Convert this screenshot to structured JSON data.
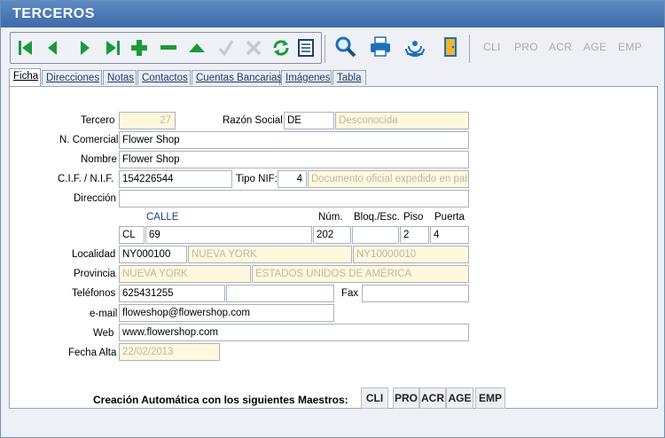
{
  "window": {
    "title": "TERCEROS"
  },
  "toolbar": {
    "nav_icons": [
      "first-icon",
      "prev-icon",
      "next-icon",
      "last-icon",
      "add-icon",
      "remove-icon",
      "up-icon",
      "confirm-icon",
      "cancel-icon",
      "refresh-icon",
      "list-icon"
    ],
    "tool_icons": [
      "search-icon",
      "print-icon",
      "signal-icon",
      "exit-door-icon"
    ],
    "text_buttons": [
      "CLI",
      "PRO",
      "ACR",
      "AGE",
      "EMP"
    ]
  },
  "tabs": [
    "Ficha",
    "Direcciones",
    "Notas",
    "Contactos",
    "Cuentas Bancarias",
    "Imágenes",
    "Tabla"
  ],
  "form": {
    "tercero_label": "Tercero",
    "tercero_value": "27",
    "razon_label": "Razón Social",
    "razon_code": "DE",
    "razon_desc": "Desconocida",
    "comercial_label": "N. Comercial",
    "comercial_value": "Flower Shop",
    "nombre_label": "Nombre",
    "nombre_value": "Flower Shop",
    "cif_label": "C.I.F. / N.I.F.",
    "cif_value": "154226544",
    "tiponif_label": "Tipo NIF:",
    "tiponif_value": "4",
    "tiponif_desc": "Documento oficial expedido en pais",
    "direccion_label": "Dirección",
    "direccion_value": "",
    "calle_hdr": "CALLE",
    "num_hdr": "Núm.",
    "bloq_hdr": "Bloq./Esc.",
    "piso_hdr": "Piso",
    "puerta_hdr": "Puerta",
    "via_type": "CL",
    "via_name": "69",
    "via_num": "202",
    "via_bloq": "",
    "via_piso": "2",
    "via_puerta": "4",
    "localidad_label": "Localidad",
    "localidad_code": "NY000100",
    "localidad_name": "NUEVA YORK",
    "localidad_extra": "NY10000010",
    "provincia_label": "Provincia",
    "provincia_name": "NUEVA YORK",
    "pais_name": "ESTADOS UNIDOS DE AMÉRICA",
    "telefonos_label": "Teléfonos",
    "telefono1": "625431255",
    "telefono2": "",
    "fax_label": "Fax",
    "fax_value": "",
    "email_label": "e-mail",
    "email_value": "floweshop@flowershop.com",
    "web_label": "Web",
    "web_value": "www.flowershop.com",
    "fecha_label": "Fecha Alta",
    "fecha_value": "22/02/2013"
  },
  "footer": {
    "creacion_label": "Creación Automática con los siguientes Maestros:",
    "buttons": [
      "CLI",
      "PRO",
      "ACR",
      "AGE",
      "EMP"
    ]
  }
}
